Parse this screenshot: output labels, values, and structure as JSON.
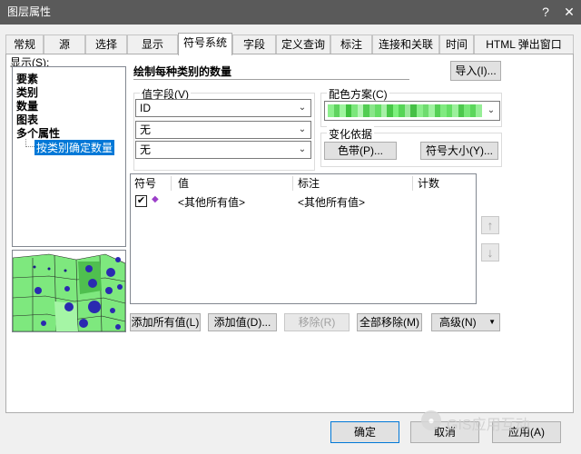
{
  "window": {
    "title": "图层属性",
    "help": "?",
    "close": "✕"
  },
  "tabs": [
    {
      "label": "常规"
    },
    {
      "label": "源"
    },
    {
      "label": "选择"
    },
    {
      "label": "显示"
    },
    {
      "label": "符号系统"
    },
    {
      "label": "字段"
    },
    {
      "label": "定义查询"
    },
    {
      "label": "标注"
    },
    {
      "label": "连接和关联"
    },
    {
      "label": "时间"
    },
    {
      "label": "HTML 弹出窗口"
    }
  ],
  "show_label": "显示(S):",
  "tree": {
    "items": [
      {
        "label": "要素"
      },
      {
        "label": "类别"
      },
      {
        "label": "数量"
      },
      {
        "label": "图表"
      },
      {
        "label": "多个属性"
      }
    ],
    "selected": "按类别确定数量"
  },
  "heading": "绘制每种类别的数量",
  "import_button": "导入(I)...",
  "value_fields": {
    "label": "值字段(V)",
    "fields": [
      {
        "value": "ID"
      },
      {
        "value": "无"
      },
      {
        "value": "无"
      }
    ]
  },
  "color_scheme": {
    "label": "配色方案(C)",
    "swatches": [
      "#8ef08e",
      "#5fd35f",
      "#9ef59e",
      "#3fc23f",
      "#7ce77c",
      "#b5f5b5",
      "#52cd52",
      "#8ae68a",
      "#66dd66",
      "#a6f0a6",
      "#48c848",
      "#7ef07e",
      "#57d557",
      "#9be89b",
      "#46c046",
      "#8bee8b",
      "#6fdc6f",
      "#a0f2a0",
      "#55d055",
      "#80ea80",
      "#64de64",
      "#9cf09c",
      "#4dc84d",
      "#78e778",
      "#5bd65b",
      "#96ee96"
    ]
  },
  "variation": {
    "label": "变化依据",
    "color_ramp_button": "色带(P)...",
    "symbol_size_button": "符号大小(Y)..."
  },
  "table": {
    "headers": {
      "symbol": "符号",
      "value": "值",
      "label": "标注",
      "count": "计数"
    },
    "rows": [
      {
        "checked": true,
        "value": "<其他所有值>",
        "label": "<其他所有值>"
      }
    ]
  },
  "move_up": "↑",
  "move_down": "↓",
  "buttons": {
    "add_all": "添加所有值(L)",
    "add_values": "添加值(D)...",
    "remove": "移除(R)",
    "remove_all": "全部移除(M)",
    "advanced": "高级(N)"
  },
  "footer": {
    "ok": "确定",
    "cancel": "取消",
    "apply": "应用(A)",
    "watermark": "GIS应用互动"
  }
}
